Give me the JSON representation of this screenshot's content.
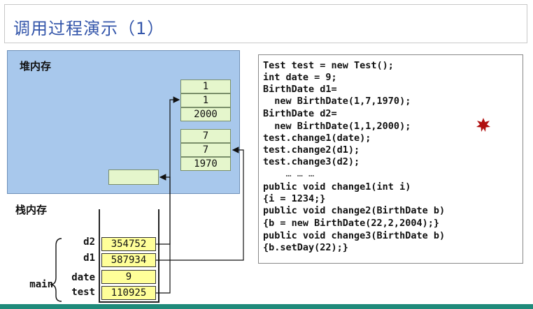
{
  "title": "调用过程演示（1）",
  "heap": {
    "label": "堆内存",
    "obj1": [
      "1",
      "1",
      "2000"
    ],
    "obj2": [
      "7",
      "7",
      "1970"
    ]
  },
  "stack": {
    "label": "栈内存",
    "frame_label": "main",
    "vars": [
      {
        "name": "d2",
        "value": "354752"
      },
      {
        "name": "d1",
        "value": "587934"
      },
      {
        "name": "date",
        "value": "9"
      },
      {
        "name": "test",
        "value": "110925"
      }
    ]
  },
  "code": {
    "lines": [
      "Test test = new Test();",
      "int date = 9;",
      "BirthDate d1=",
      "  new BirthDate(1,7,1970);",
      "BirthDate d2=",
      "  new BirthDate(1,1,2000);",
      "test.change1(date);",
      "test.change2(d1);",
      "test.change3(d2);",
      "    … … …",
      "public void change1(int i)",
      "{i = 1234;}",
      "public void change2(BirthDate b)",
      "{b = new BirthDate(22,2,2004);}",
      "public void change3(BirthDate b)",
      "{b.setDay(22);}"
    ]
  },
  "colors": {
    "heap_bg": "#a8c8ec",
    "heap_cell": "#e5f6cc",
    "stack_cell": "#ffff99",
    "title": "#3355aa",
    "marker": "#b01010"
  }
}
